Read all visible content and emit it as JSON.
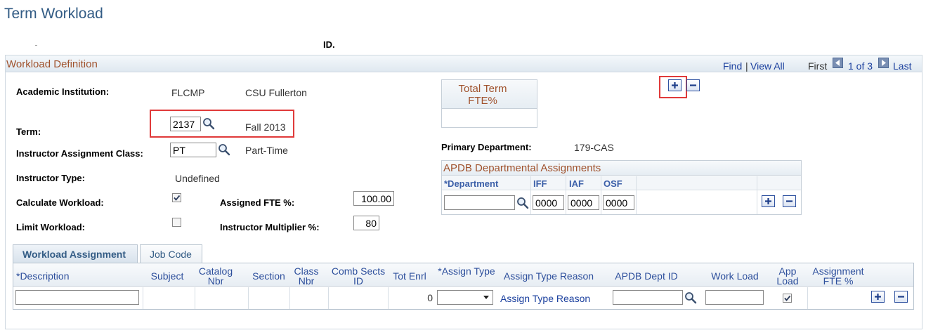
{
  "page": {
    "title": "Term Workload",
    "id_label": "ID."
  },
  "workload_definition": {
    "title": "Workload Definition",
    "nav": {
      "find": "Find",
      "separator": "|",
      "view_all": "View All",
      "first": "First",
      "counter": "1 of 3",
      "last": "Last"
    },
    "academic_institution": {
      "label": "Academic Institution:",
      "code": "FLCMP",
      "name": "CSU Fullerton"
    },
    "term": {
      "label": "Term:",
      "value": "2137",
      "description": "Fall 2013"
    },
    "instructor_assignment_class": {
      "label": "Instructor Assignment Class:",
      "value": "PT",
      "description": "Part-Time"
    },
    "instructor_type": {
      "label": "Instructor Type:",
      "value": "Undefined"
    },
    "calculate_workload": {
      "label": "Calculate Workload:",
      "checked": true
    },
    "limit_workload": {
      "label": "Limit Workload:",
      "checked": false
    },
    "assigned_fte": {
      "label": "Assigned FTE %:",
      "value": "100.00"
    },
    "instructor_multiplier": {
      "label": "Instructor Multiplier %:",
      "value": "80"
    },
    "total_term_fte": {
      "title": "Total Term FTE%"
    },
    "primary_department": {
      "label": "Primary Department:",
      "value": "179-CAS"
    },
    "apdb": {
      "title": "APDB Departmental Assignments",
      "columns": {
        "department": "*Department",
        "iff": "IFF",
        "iaf": "IAF",
        "osf": "OSF"
      },
      "row": {
        "department": "",
        "iff": "0000",
        "iaf": "0000",
        "osf": "0000"
      }
    }
  },
  "tabs": {
    "workload_assignment": "Workload Assignment",
    "job_code": "Job Code"
  },
  "grid": {
    "columns": {
      "description": "*Description",
      "subject": "Subject",
      "catalog_nbr": "Catalog Nbr",
      "section": "Section",
      "class_nbr": "Class Nbr",
      "comb_sects_id": "Comb Sects ID",
      "tot_enrl": "Tot Enrl",
      "assign_type": "*Assign Type",
      "assign_type_reason": "Assign Type Reason",
      "apdb_dept_id": "APDB Dept ID",
      "work_load": "Work Load",
      "app_load": "App Load",
      "assignment_fte": "Assignment FTE %"
    },
    "row": {
      "description": "",
      "tot_enrl": "0",
      "assign_type": "",
      "assign_type_reason": "Assign Type Reason",
      "apdb_dept_id": "",
      "work_load": "",
      "app_load_checked": true
    }
  },
  "icons": {
    "lookup": "magnifier-icon",
    "add": "plus-icon",
    "remove": "minus-icon"
  },
  "colors": {
    "title_blue": "#335c85",
    "section_brown": "#a0522d",
    "link_blue": "#1a3f9e",
    "highlight_red": "#e03a3a"
  }
}
